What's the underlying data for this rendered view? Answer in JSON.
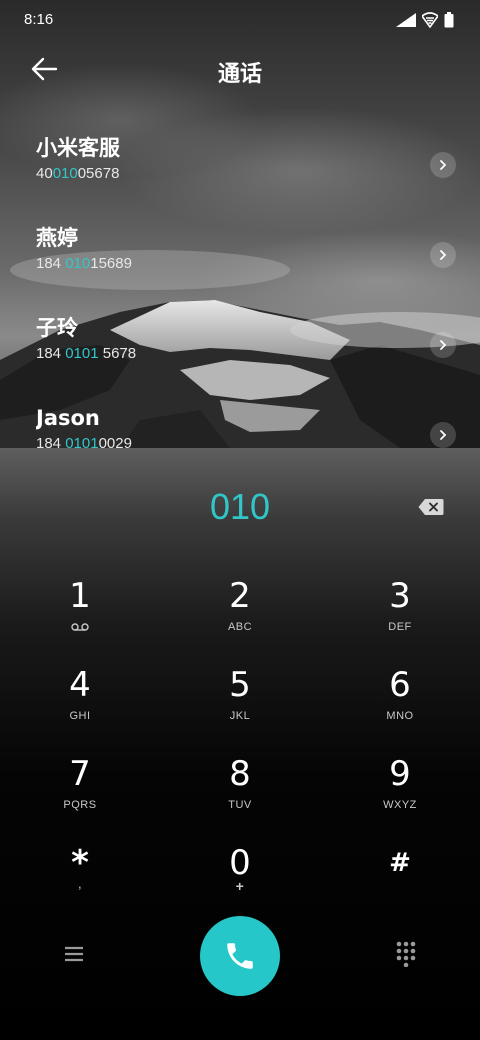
{
  "status_bar": {
    "time": "8:16"
  },
  "header": {
    "title": "通话"
  },
  "contacts": [
    {
      "name": "小米客服",
      "number_pre": "40",
      "number_match": "010",
      "number_post": "05678"
    },
    {
      "name": "燕婷",
      "number_pre": "184 ",
      "number_match": "010",
      "number_post": "15689"
    },
    {
      "name": "子玲",
      "number_pre": "184 ",
      "number_match": "0101",
      "number_post": " 5678"
    },
    {
      "name": "Jason",
      "number_pre": "184 ",
      "number_match": "0101",
      "number_post": "0029"
    }
  ],
  "dialer": {
    "entered": "010",
    "keys": [
      {
        "digit": "1",
        "letters": "",
        "icon": "voicemail-icon"
      },
      {
        "digit": "2",
        "letters": "ABC"
      },
      {
        "digit": "3",
        "letters": "DEF"
      },
      {
        "digit": "4",
        "letters": "GHI"
      },
      {
        "digit": "5",
        "letters": "JKL"
      },
      {
        "digit": "6",
        "letters": "MNO"
      },
      {
        "digit": "7",
        "letters": "PQRS"
      },
      {
        "digit": "8",
        "letters": "TUV"
      },
      {
        "digit": "9",
        "letters": "WXYZ"
      },
      {
        "digit": "*",
        "letters": ","
      },
      {
        "digit": "0",
        "letters": "+"
      },
      {
        "digit": "#",
        "letters": ""
      }
    ]
  },
  "colors": {
    "accent": "#31c7c9",
    "call_button": "#25c7c9"
  },
  "icons": {
    "menu": "menu-icon",
    "call": "phone-icon",
    "keypad": "keypad-icon",
    "backspace": "backspace-icon"
  }
}
